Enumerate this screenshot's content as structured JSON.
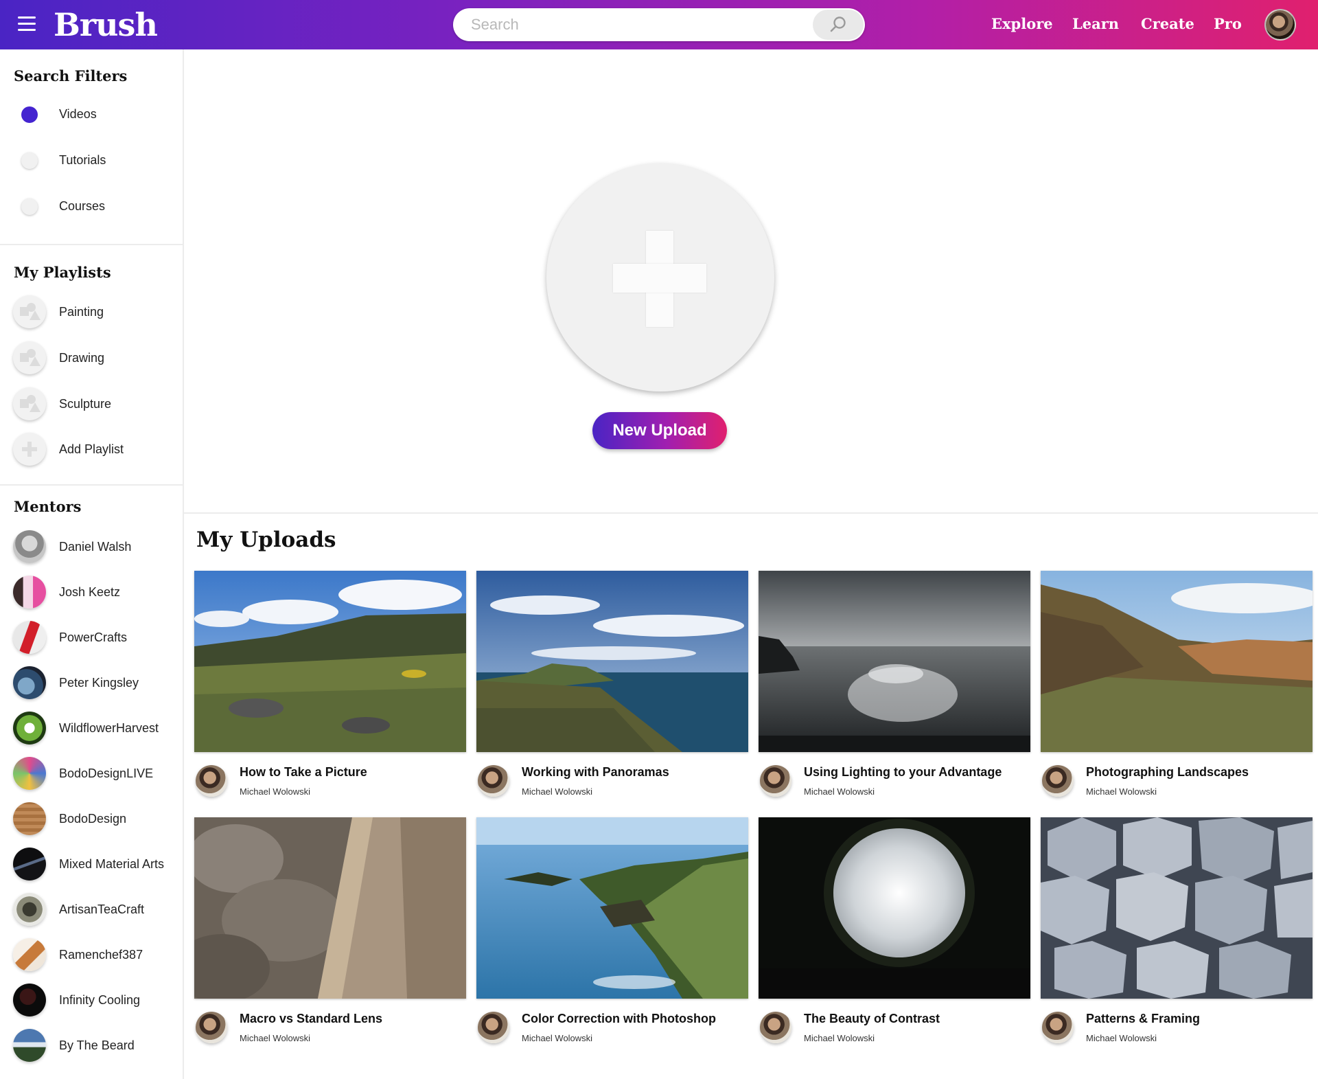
{
  "header": {
    "logo": "Brush",
    "search_placeholder": "Search",
    "nav": [
      "Explore",
      "Learn",
      "Create",
      "Pro"
    ]
  },
  "sidebar": {
    "filters_heading": "Search Filters",
    "filters": [
      {
        "label": "Videos",
        "selected": true
      },
      {
        "label": "Tutorials",
        "selected": false
      },
      {
        "label": "Courses",
        "selected": false
      }
    ],
    "playlists_heading": "My Playlists",
    "playlists": [
      "Painting",
      "Drawing",
      "Sculpture"
    ],
    "add_playlist": "Add Playlist",
    "mentors_heading": "Mentors",
    "mentors": [
      "Daniel Walsh",
      "Josh Keetz",
      "PowerCrafts",
      "Peter Kingsley",
      "WildflowerHarvest",
      "BodoDesignLIVE",
      "BodoDesign",
      "Mixed Material Arts",
      "ArtisanTeaCraft",
      "Ramenchef387",
      "Infinity Cooling",
      "By The Beard"
    ]
  },
  "upload": {
    "button": "New Upload"
  },
  "uploads": {
    "heading": "My Uploads",
    "items": [
      {
        "title": "How to Take a Picture",
        "author": "Michael Wolowski"
      },
      {
        "title": "Working with Panoramas",
        "author": "Michael Wolowski"
      },
      {
        "title": "Using Lighting to your Advantage",
        "author": "Michael Wolowski"
      },
      {
        "title": "Photographing Landscapes",
        "author": "Michael Wolowski"
      },
      {
        "title": "Macro vs Standard Lens",
        "author": "Michael Wolowski"
      },
      {
        "title": "Color Correction with Photoshop",
        "author": "Michael Wolowski"
      },
      {
        "title": "The Beauty of Contrast",
        "author": "Michael Wolowski"
      },
      {
        "title": "Patterns & Framing",
        "author": "Michael Wolowski"
      }
    ]
  },
  "colors": {
    "brand_start": "#4a24c4",
    "brand_end": "#e0206e",
    "selected_radio": "#4424d0"
  }
}
